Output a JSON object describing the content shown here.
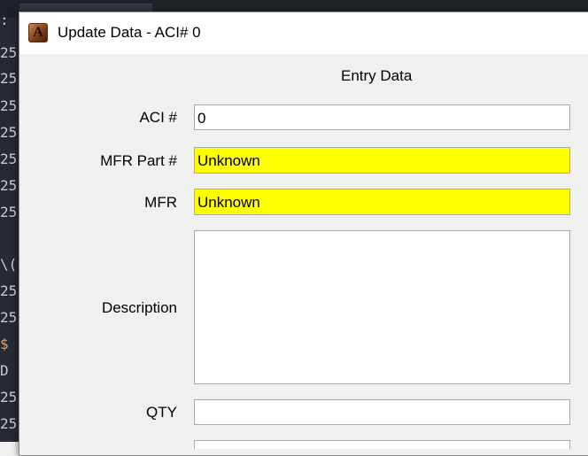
{
  "dialog": {
    "title": "Update Data - ACI# 0",
    "icon": "access-app-icon",
    "icon_glyph": "A"
  },
  "form": {
    "heading": "Entry Data",
    "fields": {
      "aci": {
        "label": "ACI #",
        "value": "0"
      },
      "mfr_part": {
        "label": "MFR Part #",
        "value": "Unknown",
        "highlight_color": "#ffff00"
      },
      "mfr": {
        "label": "MFR",
        "value": "Unknown",
        "highlight_color": "#ffff00"
      },
      "description": {
        "label": "Description",
        "value": ""
      },
      "qty": {
        "label": "QTY",
        "value": ""
      }
    }
  },
  "background": {
    "gutter_chars": [
      ":",
      "25",
      "25",
      "25",
      "25",
      "25",
      "25",
      "25",
      "\\(",
      "25",
      "25",
      "$",
      "D",
      "25",
      "25"
    ]
  }
}
